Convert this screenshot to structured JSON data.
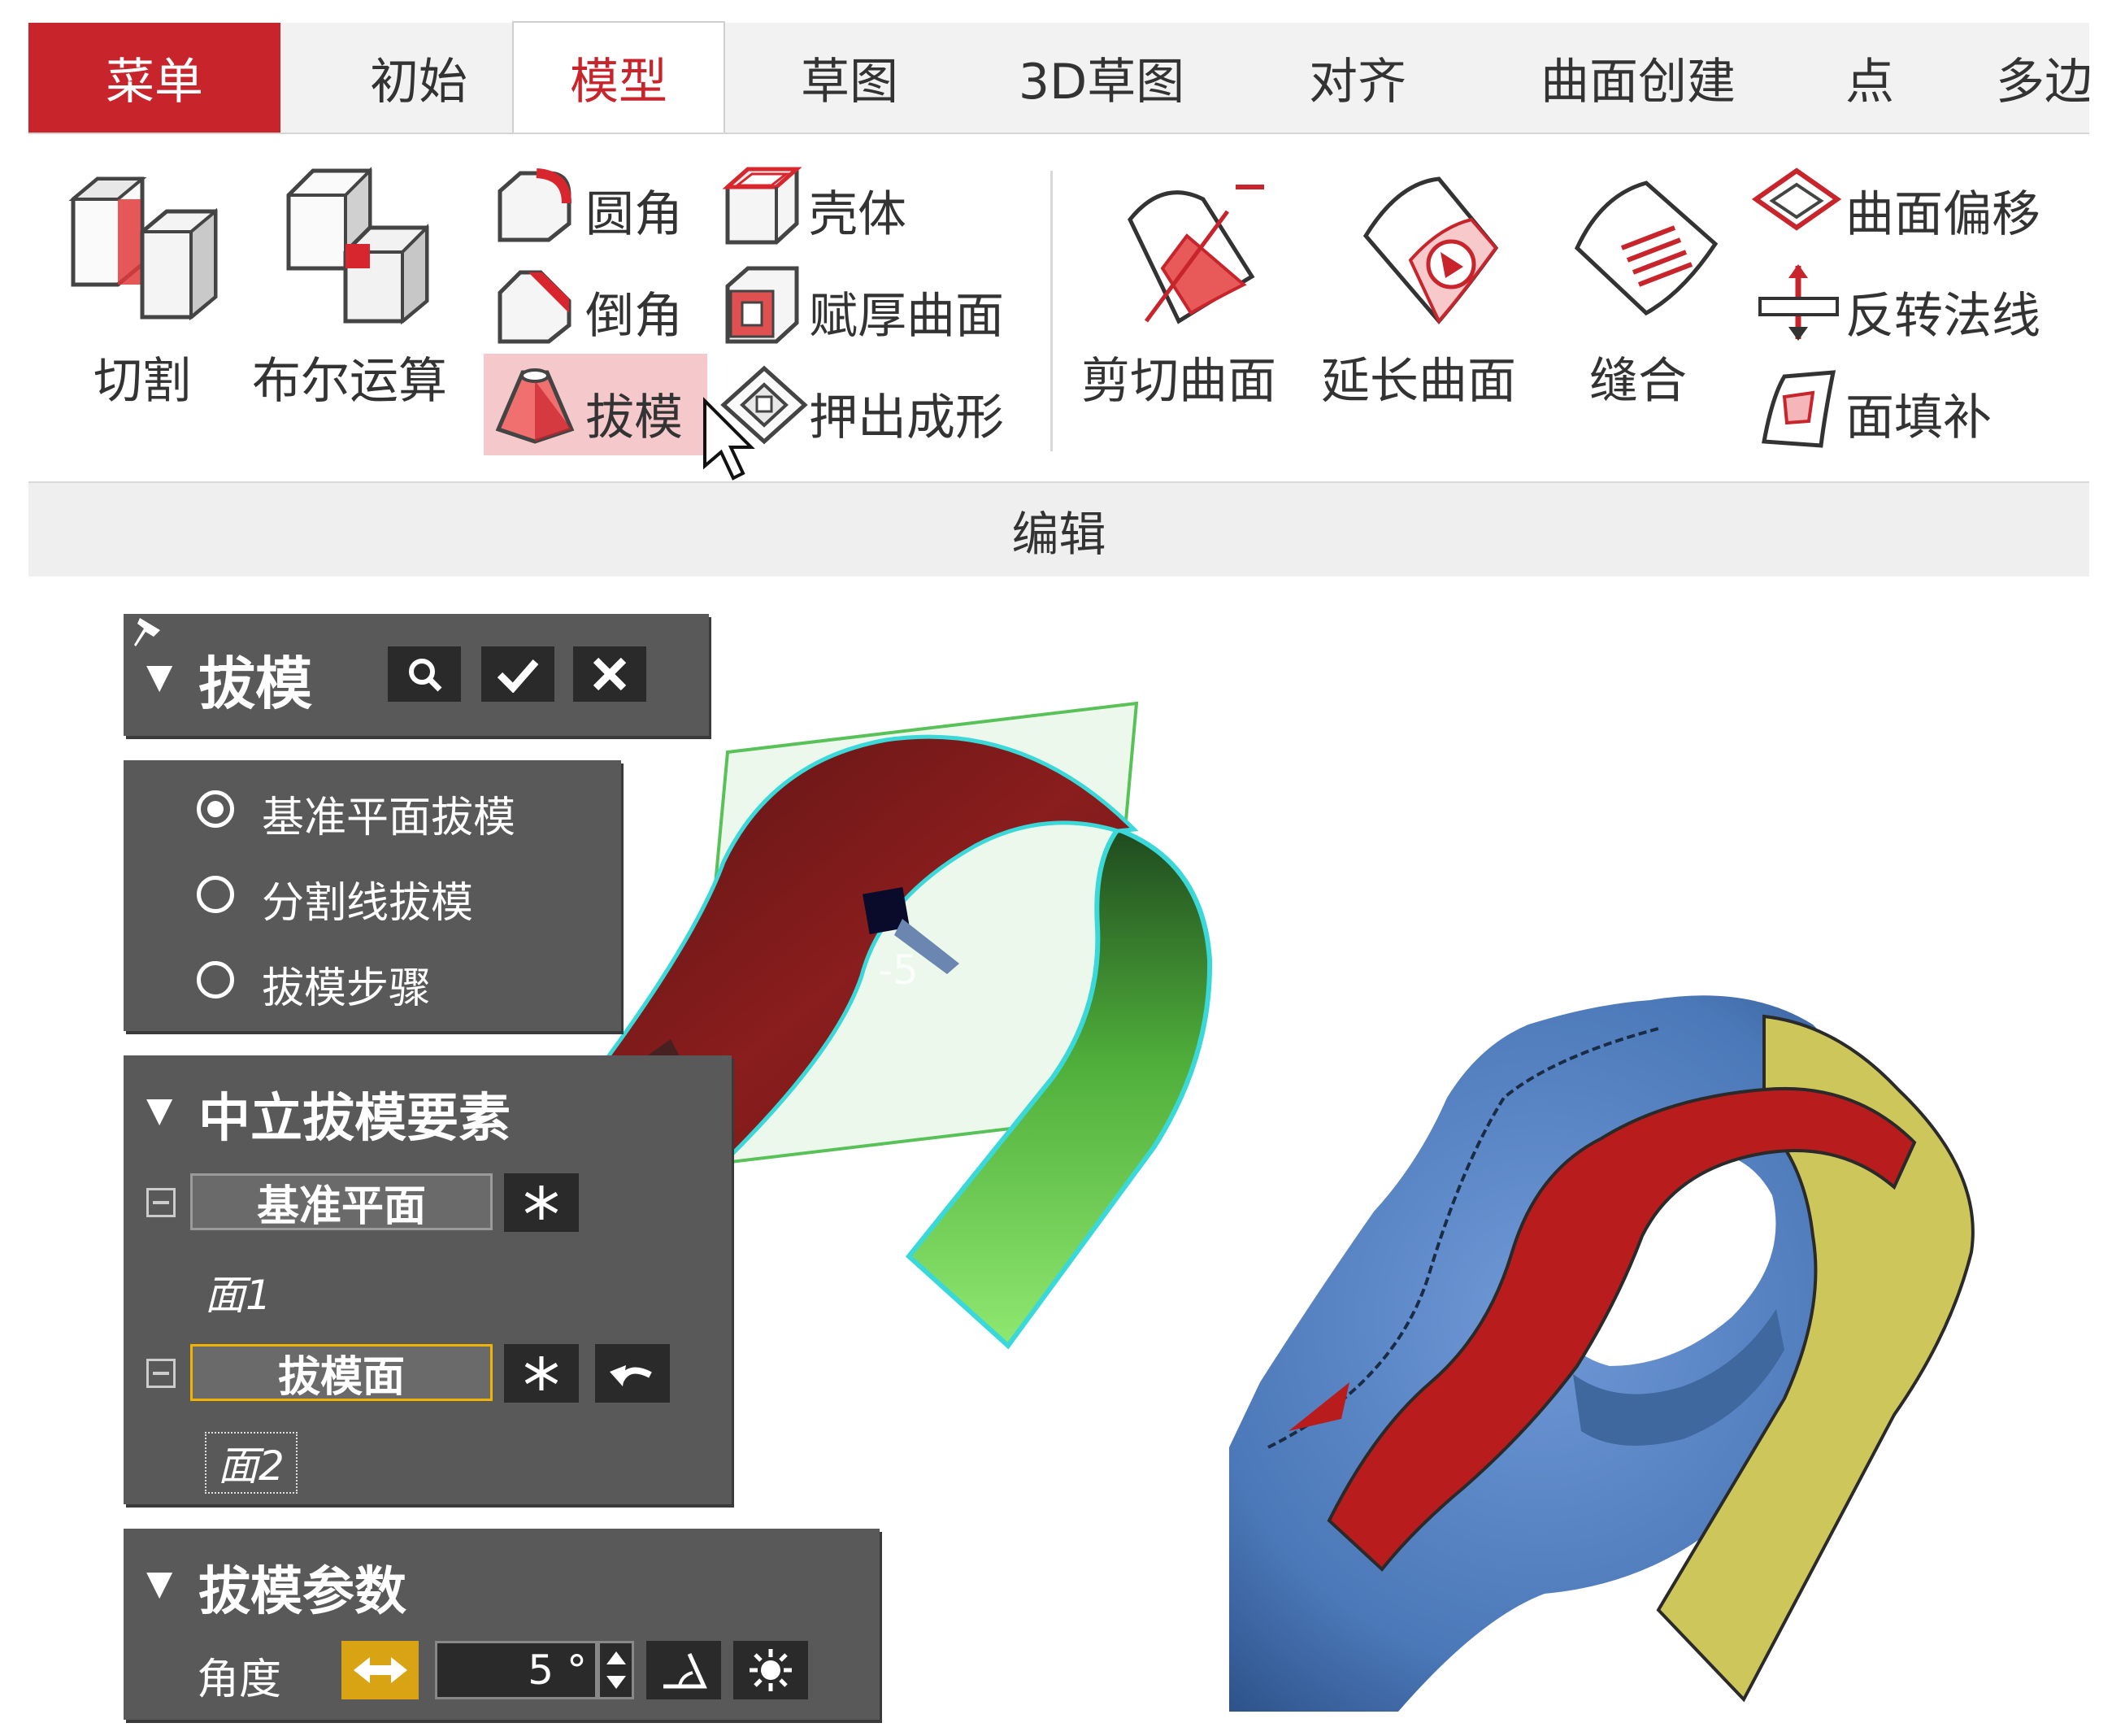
{
  "tabs": [
    "菜单",
    "初始",
    "模型",
    "草图",
    "3D草图",
    "对齐",
    "曲面创建",
    "点",
    "多边"
  ],
  "ribbon": {
    "cut": "切割",
    "boolean": "布尔运算",
    "fillet": "圆角",
    "chamfer": "倒角",
    "draft": "拔模",
    "shell": "壳体",
    "thicken": "赋厚曲面",
    "emboss": "押出成形",
    "trim_surface": "剪切曲面",
    "extend_surface": "延长曲面",
    "stitch": "缝合",
    "offset_surface": "曲面偏移",
    "reverse_normal": "反转法线",
    "fill_face": "面填补",
    "group_label": "编辑"
  },
  "draft_panel": {
    "title": "拔模",
    "options": [
      "基准平面拔模",
      "分割线拔模",
      "拔模步骤"
    ],
    "selected_option": 0
  },
  "neutral_panel": {
    "title": "中立拔模要素",
    "plane_field": "基准平面",
    "plane_value": "面1",
    "draft_face_field": "拔模面",
    "draft_face_value": "面2"
  },
  "params_panel": {
    "title": "拔模参数",
    "angle_label": "角度",
    "angle_value": "5 °"
  },
  "viewport": {
    "angle_tag": "-5"
  },
  "colors": {
    "accent": "#c8242c",
    "panel_bg": "#595959",
    "active_field": "#f0b400",
    "model_blue": "#5a86c5",
    "draft_red": "#b81c1c",
    "draft_yellow": "#cdc65a",
    "surface_green": "#6bd24f"
  }
}
